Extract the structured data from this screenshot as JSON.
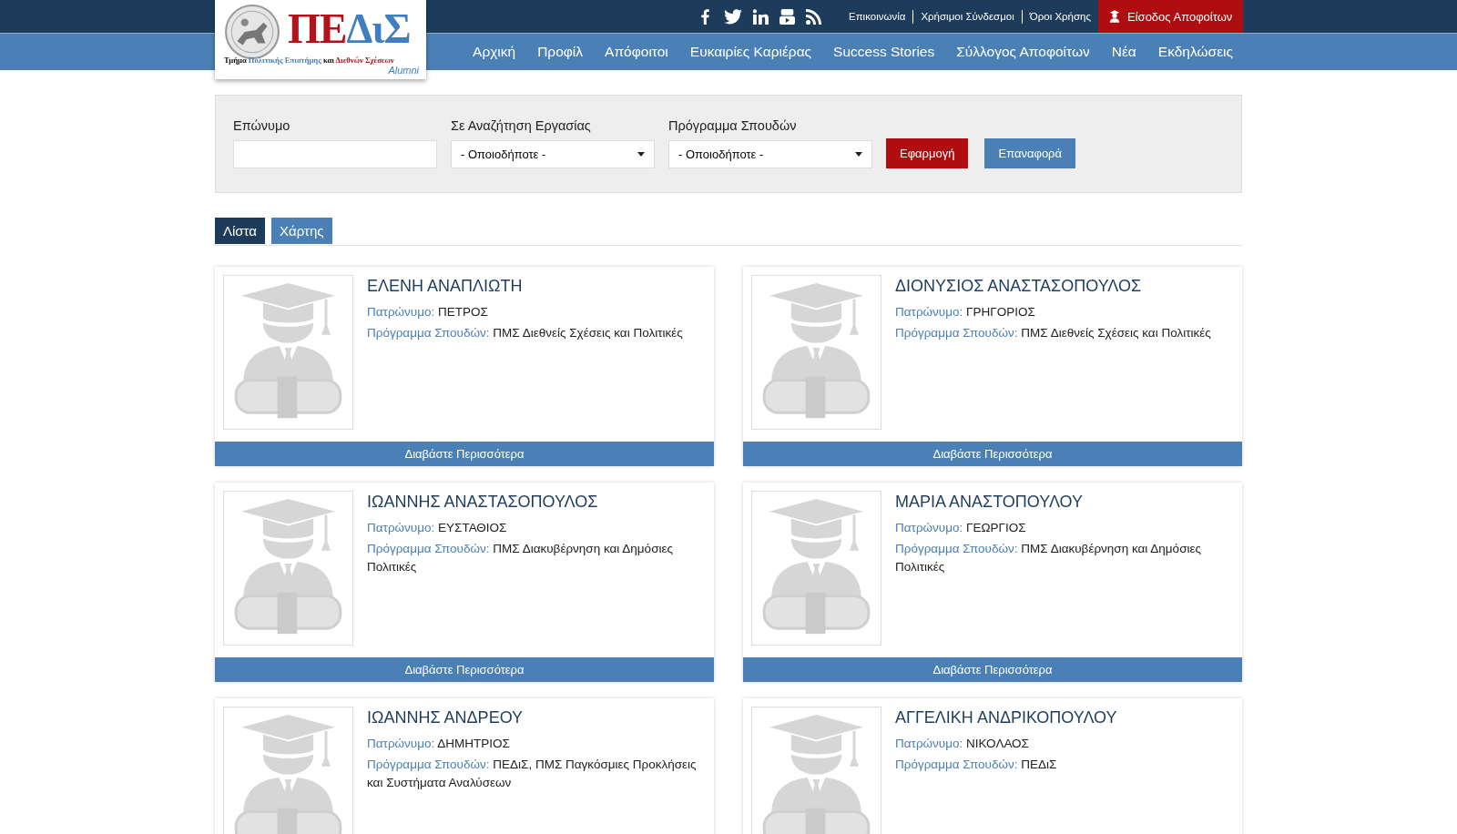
{
  "logo": {
    "title_parts": [
      {
        "text": "ΠΕ",
        "color": "#b3121b"
      },
      {
        "text": "ΔιΣ",
        "color": "#3f7fbf"
      }
    ],
    "subtitle_parts": [
      {
        "text": "Τμήμα ",
        "color": "#111111"
      },
      {
        "text": "Πολιτικής Επιστήμης ",
        "color": "#4a7fb5"
      },
      {
        "text": "και ",
        "color": "#111111"
      },
      {
        "text": "Διεθνών Σχέσεων",
        "color": "#b3121b"
      }
    ],
    "tagline": "Alumni"
  },
  "social": [
    {
      "kind": "facebook"
    },
    {
      "kind": "twitter"
    },
    {
      "kind": "linkedin"
    },
    {
      "kind": "youtube"
    },
    {
      "kind": "rss"
    }
  ],
  "top_links": [
    "Επικοινωνία",
    "Χρήσιμοι Σύνδεσμοι",
    "Όροι Χρήσης"
  ],
  "login_button": "Είσοδος Αποφοίτων",
  "nav": [
    "Αρχική",
    "Προφίλ",
    "Απόφοιτοι",
    "Ευκαιρίες Καριέρας",
    "Success Stories",
    "Σύλλογος Αποφοίτων",
    "Νέα",
    "Εκδηλώσεις"
  ],
  "filters": {
    "fields": [
      {
        "kind": "text",
        "label": "Επώνυμο"
      },
      {
        "kind": "select",
        "label": "Σε Αναζήτηση Εργασίας",
        "value": "- Οποιοδήποτε -"
      },
      {
        "kind": "select",
        "label": "Πρόγραμμα Σπουδών",
        "value": "- Οποιοδήποτε -"
      }
    ],
    "apply_button": "Εφαρμογή",
    "reset_button": "Επαναφορά"
  },
  "view_tabs": [
    {
      "label": "Λίστα",
      "selected": true
    },
    {
      "label": "Χάρτης",
      "selected": false
    }
  ],
  "cards": [
    {
      "name": "ΕΛΕΝΗ ΑΝΑΠΛΙΩΤΗ",
      "patronymic_label": "Πατρώνυμο:",
      "patronymic": "ΠΕΤΡΟΣ",
      "program_label": "Πρόγραμμα Σπουδών:",
      "program": "ΠΜΣ Διεθνείς Σχέσεις και Πολιτικές",
      "read_more": "Διαβάστε Περισσότερα"
    },
    {
      "name": "ΔΙΟΝΥΣΙΟΣ ΑΝΑΣΤΑΣΟΠΟΥΛΟΣ",
      "patronymic_label": "Πατρώνυμο:",
      "patronymic": "ΓΡΗΓΟΡΙΟΣ",
      "program_label": "Πρόγραμμα Σπουδών:",
      "program": "ΠΜΣ Διεθνείς Σχέσεις και Πολιτικές",
      "read_more": "Διαβάστε Περισσότερα"
    },
    {
      "name": "ΙΩΑΝΝΗΣ ΑΝΑΣΤΑΣΟΠΟΥΛΟΣ",
      "patronymic_label": "Πατρώνυμο:",
      "patronymic": "ΕΥΣΤΑΘΙΟΣ",
      "program_label": "Πρόγραμμα Σπουδών:",
      "program": "ΠΜΣ Διακυβέρνηση και Δημόσιες Πολιτικές",
      "read_more": "Διαβάστε Περισσότερα"
    },
    {
      "name": "ΜΑΡΙΑ ΑΝΑΣΤΟΠΟΥΛΟΥ",
      "patronymic_label": "Πατρώνυμο:",
      "patronymic": "ΓΕΩΡΓΙΟΣ",
      "program_label": "Πρόγραμμα Σπουδών:",
      "program": "ΠΜΣ Διακυβέρνηση και Δημόσιες Πολιτικές",
      "read_more": "Διαβάστε Περισσότερα"
    },
    {
      "name": "ΙΩΑΝΝΗΣ ΑΝΔΡΕΟΥ",
      "patronymic_label": "Πατρώνυμο:",
      "patronymic": "ΔΗΜΗΤΡΙΟΣ",
      "program_label": "Πρόγραμμα Σπουδών:",
      "program": "ΠΕΔιΣ, ΠΜΣ Παγκόσμιες Προκλήσεις και Συστήματα Αναλύσεων"
    },
    {
      "name": "ΑΓΓΕΛΙΚΗ ΑΝΔΡΙΚΟΠΟΥΛΟΥ",
      "patronymic_label": "Πατρώνυμο:",
      "patronymic": "ΝΙΚΟΛΑΟΣ",
      "program_label": "Πρόγραμμα Σπουδών:",
      "program": "ΠΕΔιΣ"
    }
  ]
}
